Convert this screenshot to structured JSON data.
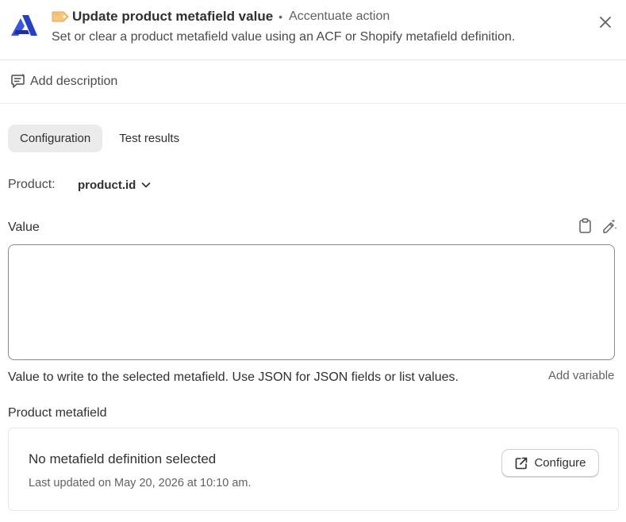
{
  "header": {
    "title": "Update product metafield value",
    "source": "Accentuate action",
    "subtitle": "Set or clear a product metafield value using an ACF or Shopify metafield definition.",
    "brand_color": "#2440c8",
    "icons": {
      "app": "accentuate-logo-icon",
      "title": "tag-icon",
      "close": "close-icon"
    }
  },
  "description": {
    "label": "Add description",
    "icon": "speech-bubble-icon"
  },
  "tabs": [
    {
      "label": "Configuration",
      "active": true
    },
    {
      "label": "Test results",
      "active": false
    }
  ],
  "product": {
    "label": "Product:",
    "value": "product.id",
    "icon": "chevron-down-icon"
  },
  "value_field": {
    "label": "Value",
    "value": "",
    "help": "Value to write to the selected metafield. Use JSON for JSON fields or list values.",
    "add_variable": "Add variable",
    "icons": [
      "clipboard-icon",
      "pen-sparkle-icon"
    ]
  },
  "metafield": {
    "label": "Product metafield",
    "title": "No metafield definition selected",
    "updated": "Last updated on May 20, 2026 at 10:10 am.",
    "configure_label": "Configure",
    "configure_icon": "external-link-icon"
  }
}
